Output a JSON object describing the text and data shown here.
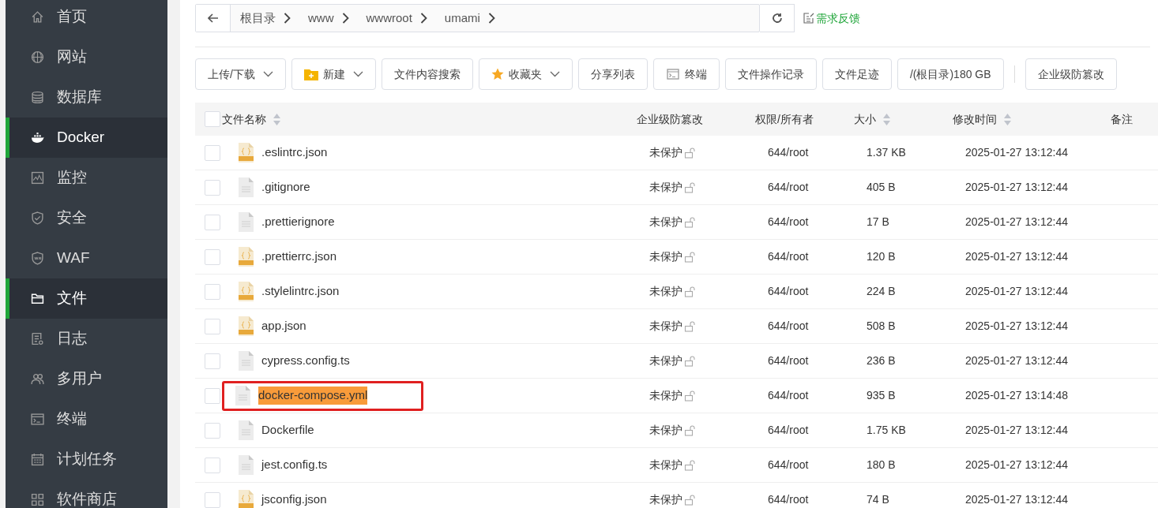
{
  "sidebar": {
    "items": [
      {
        "label": "首页",
        "selected": false
      },
      {
        "label": "网站",
        "selected": false
      },
      {
        "label": "数据库",
        "selected": false
      },
      {
        "label": "Docker",
        "selected": true
      },
      {
        "label": "监控",
        "selected": false
      },
      {
        "label": "安全",
        "selected": false
      },
      {
        "label": "WAF",
        "selected": false
      },
      {
        "label": "文件",
        "selected": true
      },
      {
        "label": "日志",
        "selected": false
      },
      {
        "label": "多用户",
        "selected": false
      },
      {
        "label": "终端",
        "selected": false
      },
      {
        "label": "计划任务",
        "selected": false
      },
      {
        "label": "软件商店",
        "selected": false
      }
    ]
  },
  "breadcrumb": [
    "根目录",
    "www",
    "wwwroot",
    "umami"
  ],
  "feedback_link": "需求反馈",
  "toolbar": [
    {
      "label": "上传/下载",
      "kind": "plain",
      "dropdown": true
    },
    {
      "label": "新建",
      "kind": "folder",
      "dropdown": true
    },
    {
      "label": "文件内容搜索",
      "kind": "plain",
      "dropdown": false
    },
    {
      "label": "收藏夹",
      "kind": "star",
      "dropdown": true
    },
    {
      "label": "分享列表",
      "kind": "plain",
      "dropdown": false
    },
    {
      "label": "终端",
      "kind": "terminal",
      "dropdown": false
    },
    {
      "label": "文件操作记录",
      "kind": "plain",
      "dropdown": false
    },
    {
      "label": "文件足迹",
      "kind": "plain",
      "dropdown": false
    },
    {
      "label": "/(根目录)180 GB",
      "kind": "plain",
      "dropdown": false
    },
    {
      "label": "企业级防篡改",
      "kind": "plain",
      "dropdown": false
    }
  ],
  "table": {
    "select_all": {
      "checked": false
    },
    "columns": [
      {
        "label": "文件名称",
        "sortable": true
      },
      {
        "label": "企业级防篡改",
        "sortable": false
      },
      {
        "label": "权限/所有者",
        "sortable": false
      },
      {
        "label": "大小",
        "sortable": true
      },
      {
        "label": "修改时间",
        "sortable": true
      },
      {
        "label": "备注",
        "sortable": false
      }
    ],
    "rows": [
      {
        "kind": "json",
        "name": ".eslintrc.json",
        "protection": "未保护",
        "perms": "644/root",
        "size": "1.37 KB",
        "modified": "2025-01-27 13:12:44",
        "highlighted": false,
        "checked": false
      },
      {
        "kind": "text",
        "name": ".gitignore",
        "protection": "未保护",
        "perms": "644/root",
        "size": "405 B",
        "modified": "2025-01-27 13:12:44",
        "highlighted": false,
        "checked": false
      },
      {
        "kind": "text",
        "name": ".prettierignore",
        "protection": "未保护",
        "perms": "644/root",
        "size": "17 B",
        "modified": "2025-01-27 13:12:44",
        "highlighted": false,
        "checked": false
      },
      {
        "kind": "json",
        "name": ".prettierrc.json",
        "protection": "未保护",
        "perms": "644/root",
        "size": "120 B",
        "modified": "2025-01-27 13:12:44",
        "highlighted": false,
        "checked": false
      },
      {
        "kind": "json",
        "name": ".stylelintrc.json",
        "protection": "未保护",
        "perms": "644/root",
        "size": "224 B",
        "modified": "2025-01-27 13:12:44",
        "highlighted": false,
        "checked": false
      },
      {
        "kind": "json",
        "name": "app.json",
        "protection": "未保护",
        "perms": "644/root",
        "size": "508 B",
        "modified": "2025-01-27 13:12:44",
        "highlighted": false,
        "checked": false
      },
      {
        "kind": "text",
        "name": "cypress.config.ts",
        "protection": "未保护",
        "perms": "644/root",
        "size": "236 B",
        "modified": "2025-01-27 13:12:44",
        "highlighted": false,
        "checked": false
      },
      {
        "kind": "text",
        "name": "docker-compose.yml",
        "protection": "未保护",
        "perms": "644/root",
        "size": "935 B",
        "modified": "2025-01-27 13:14:48",
        "highlighted": true,
        "checked": false
      },
      {
        "kind": "text",
        "name": "Dockerfile",
        "protection": "未保护",
        "perms": "644/root",
        "size": "1.75 KB",
        "modified": "2025-01-27 13:12:44",
        "highlighted": false,
        "checked": false
      },
      {
        "kind": "text",
        "name": "jest.config.ts",
        "protection": "未保护",
        "perms": "644/root",
        "size": "180 B",
        "modified": "2025-01-27 13:12:44",
        "highlighted": false,
        "checked": false
      },
      {
        "kind": "json",
        "name": "jsconfig.json",
        "protection": "未保护",
        "perms": "644/root",
        "size": "74 B",
        "modified": "2025-01-27 13:12:44",
        "highlighted": false,
        "checked": false
      }
    ]
  }
}
